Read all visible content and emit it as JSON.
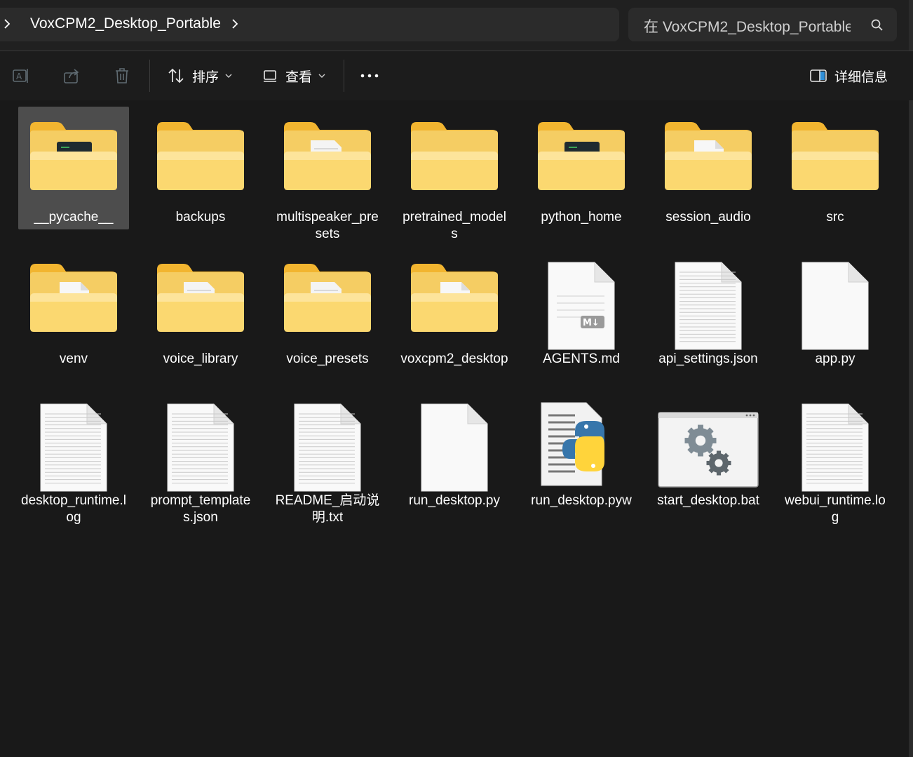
{
  "address": {
    "path": "VoxCPM2_Desktop_Portable"
  },
  "search": {
    "placeholder": "在 VoxCPM2_Desktop_Portable 中搜索"
  },
  "toolbar": {
    "sort": "排序",
    "view": "查看",
    "details": "详细信息"
  },
  "items": [
    {
      "name": "__pycache__",
      "type": "folder",
      "overlay": "python-script-icon",
      "selected": true
    },
    {
      "name": "backups",
      "type": "folder"
    },
    {
      "name": "multispeaker_presets",
      "type": "folder",
      "overlay": "text-doc-icon"
    },
    {
      "name": "pretrained_models",
      "type": "folder"
    },
    {
      "name": "python_home",
      "type": "folder",
      "overlay": "python-script-icon"
    },
    {
      "name": "session_audio",
      "type": "folder",
      "overlay": "blank-doc-icon"
    },
    {
      "name": "src",
      "type": "folder"
    },
    {
      "name": "venv",
      "type": "folder",
      "overlay": "blank-doc-icon"
    },
    {
      "name": "voice_library",
      "type": "folder",
      "overlay": "text-doc-icon"
    },
    {
      "name": "voice_presets",
      "type": "folder",
      "overlay": "text-doc-icon"
    },
    {
      "name": "voxcpm2_desktop",
      "type": "folder",
      "overlay": "blank-doc-icon"
    },
    {
      "name": "AGENTS.md",
      "type": "markdown"
    },
    {
      "name": "api_settings.json",
      "type": "text"
    },
    {
      "name": "app.py",
      "type": "blank"
    },
    {
      "name": "desktop_runtime.log",
      "type": "text"
    },
    {
      "name": "prompt_templates.json",
      "type": "text"
    },
    {
      "name": "README_启动说明.txt",
      "type": "text"
    },
    {
      "name": "run_desktop.py",
      "type": "blank"
    },
    {
      "name": "run_desktop.pyw",
      "type": "python"
    },
    {
      "name": "start_desktop.bat",
      "type": "batch"
    },
    {
      "name": "webui_runtime.log",
      "type": "text"
    }
  ]
}
